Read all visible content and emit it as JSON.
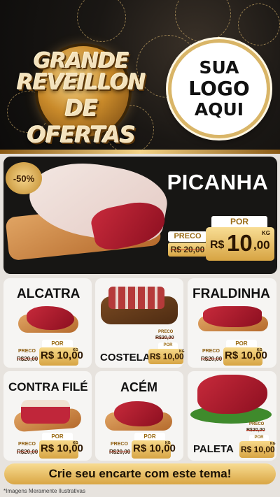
{
  "header": {
    "title_line1": "GRANDE",
    "title_line2": "REVEILLON",
    "title_line3": "DE OFERTAS",
    "logo_line1": "SUA",
    "logo_line2": "LOGO",
    "logo_line3": "AQUI"
  },
  "featured": {
    "discount": "-50%",
    "name": "PICANHA",
    "preco_label": "PRECO",
    "old_price": "R$ 20,00",
    "por_label": "POR",
    "currency": "R$",
    "price_int": "10",
    "price_dec": ",00",
    "unit": "KG"
  },
  "products": [
    {
      "name": "ALCATRA",
      "preco_label": "PRECO",
      "old_price": "R$20,00",
      "por_label": "POR",
      "price": "R$ 10,00",
      "unit": "KG"
    },
    {
      "name": "COSTELA",
      "preco_label": "PRECO",
      "old_price": "R$20,00",
      "por_label": "POR",
      "price": "R$ 10,00",
      "unit": "KG"
    },
    {
      "name": "FRALDINHA",
      "preco_label": "PRECO",
      "old_price": "R$20,00",
      "por_label": "POR",
      "price": "R$ 10,00",
      "unit": "KG"
    },
    {
      "name": "CONTRA FILÉ",
      "preco_label": "PRECO",
      "old_price": "R$20,00",
      "por_label": "POR",
      "price": "R$ 10,00",
      "unit": "KG"
    },
    {
      "name": "ACÉM",
      "preco_label": "PRECO",
      "old_price": "R$20,00",
      "por_label": "POR",
      "price": "R$ 10,00",
      "unit": "KG"
    },
    {
      "name": "PALETA",
      "preco_label": "PRECO",
      "old_price": "R$20,00",
      "por_label": "POR",
      "price": "R$ 10,00",
      "unit": "KG"
    }
  ],
  "cta": "Crie seu encarte com este tema!",
  "footnote": "*Imagens Meramente Ilustrativas"
}
